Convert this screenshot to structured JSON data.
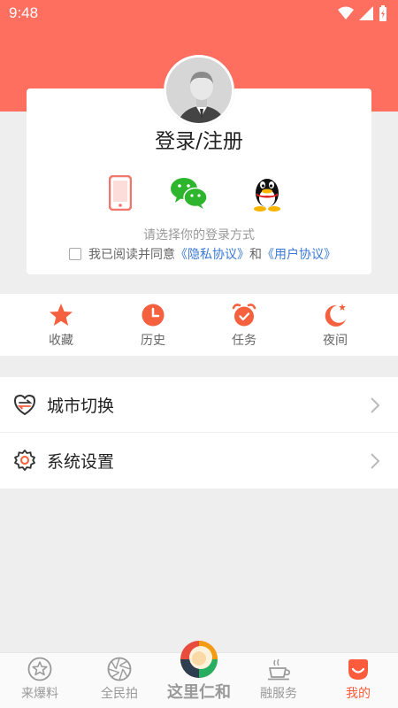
{
  "status_bar": {
    "time": "9:48"
  },
  "login": {
    "title": "登录/注册",
    "methods": [
      {
        "name": "phone-login-icon"
      },
      {
        "name": "wechat-login-icon"
      },
      {
        "name": "qq-login-icon"
      }
    ],
    "hint": "请选择你的登录方式",
    "agree_prefix": "我已阅读并同意",
    "privacy_link": "《隐私协议》",
    "agree_and": "和",
    "user_link": "《用户协议》"
  },
  "quick": [
    {
      "label": "收藏",
      "icon": "star-icon"
    },
    {
      "label": "历史",
      "icon": "clock-icon"
    },
    {
      "label": "任务",
      "icon": "alarm-icon"
    },
    {
      "label": "夜间",
      "icon": "moon-icon"
    }
  ],
  "menu": [
    {
      "label": "城市切换",
      "icon": "city-switch-icon"
    },
    {
      "label": "系统设置",
      "icon": "settings-gear-icon"
    }
  ],
  "tabs": {
    "t1": "来爆料",
    "t2": "全民拍",
    "center": "这里仁和",
    "t4": "融服务",
    "t5": "我的"
  },
  "colors": {
    "accent": "#fe6f5f",
    "active_tab": "#fe5a3c",
    "link": "#3a79d6"
  }
}
